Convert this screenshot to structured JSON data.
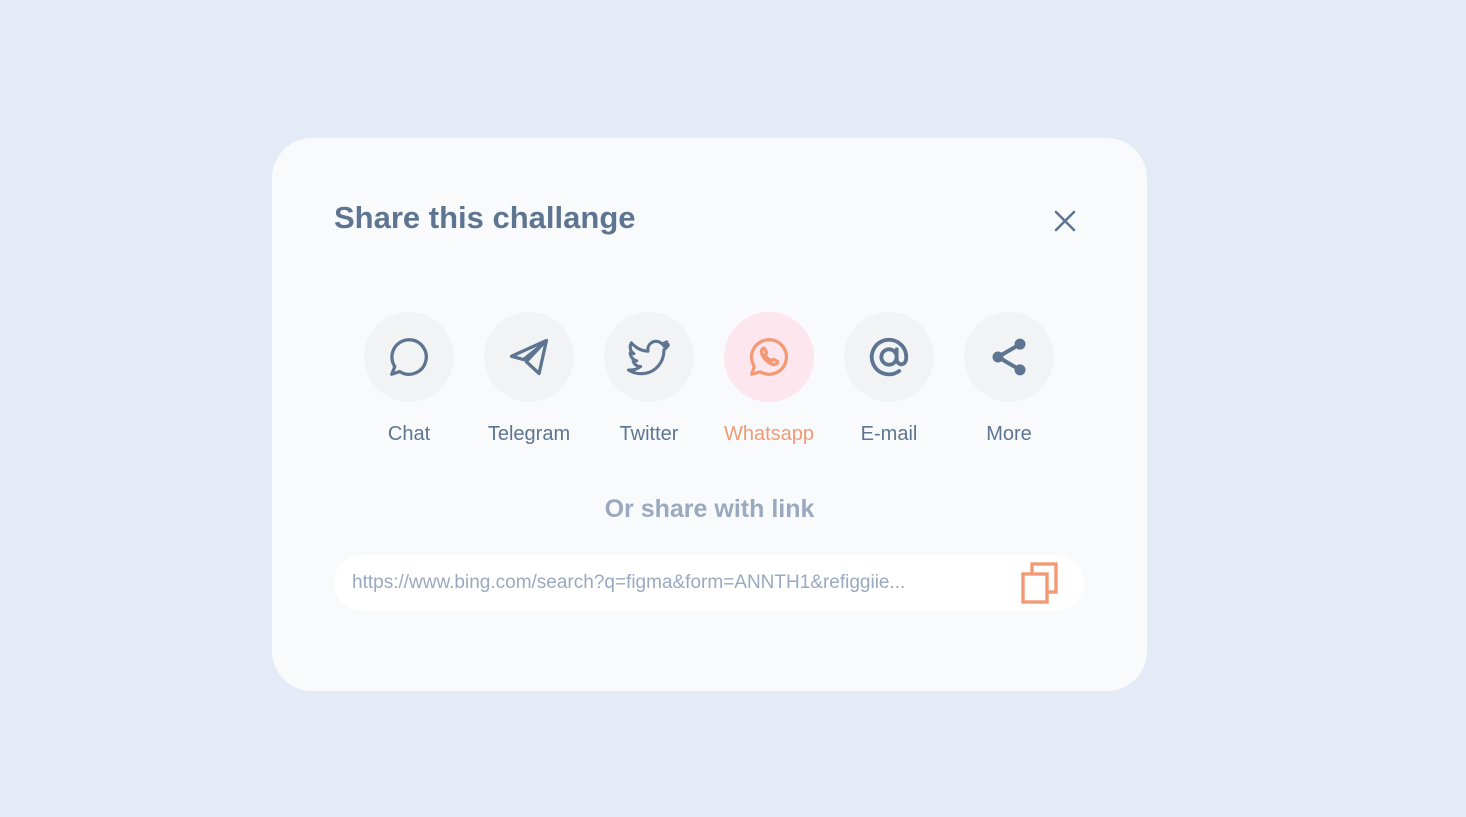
{
  "modal": {
    "title": "Share this challange",
    "subtitle": "Or share with link"
  },
  "share_options": [
    {
      "label": "Chat",
      "icon": "chat-bubble-icon"
    },
    {
      "label": "Telegram",
      "icon": "telegram-icon"
    },
    {
      "label": "Twitter",
      "icon": "twitter-icon"
    },
    {
      "label": "Whatsapp",
      "icon": "whatsapp-icon",
      "active": true
    },
    {
      "label": "E-mail",
      "icon": "at-sign-icon"
    },
    {
      "label": "More",
      "icon": "share-icon"
    }
  ],
  "link": {
    "value": "https://www.bing.com/search?q=figma&form=ANNTH1&refiggiie..."
  },
  "colors": {
    "background": "#e4ebf6",
    "card": "#f8fafc",
    "text_primary": "#5e7591",
    "text_muted": "#9aa9bf",
    "accent": "#f39a75",
    "accent_bg": "#fde6ee",
    "option_bg": "#f2f3f5"
  }
}
